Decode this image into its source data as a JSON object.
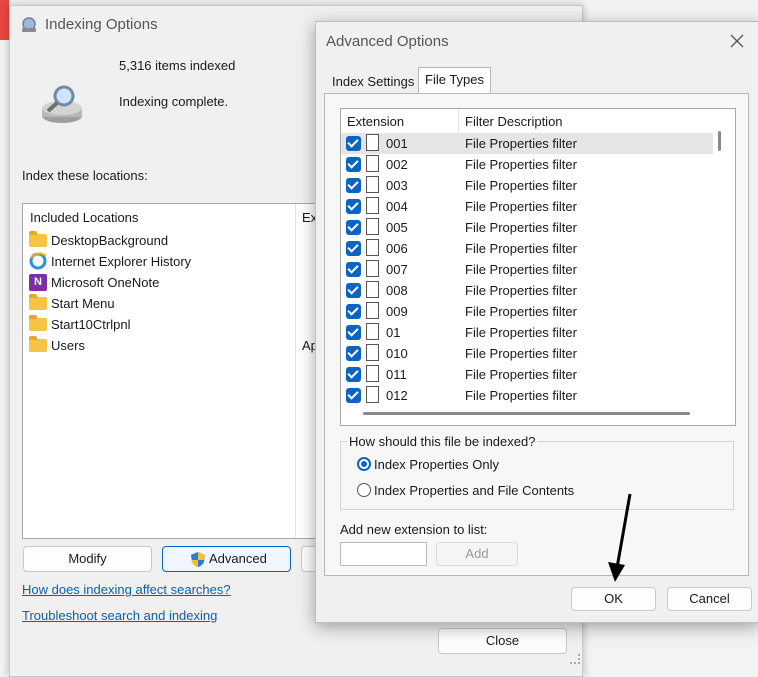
{
  "indexing_window": {
    "title": "Indexing Options",
    "items_indexed": "5,316 items indexed",
    "status": "Indexing complete.",
    "index_locations_label": "Index these locations:",
    "col_included": "Included Locations",
    "col_excluded_partial": "Ex",
    "locations": [
      {
        "name": "DesktopBackground",
        "icon": "folder-icon",
        "exclude": ""
      },
      {
        "name": "Internet Explorer History",
        "icon": "ie-icon",
        "exclude": ""
      },
      {
        "name": "Microsoft OneNote",
        "icon": "onenote-icon",
        "exclude": ""
      },
      {
        "name": "Start Menu",
        "icon": "folder-icon",
        "exclude": ""
      },
      {
        "name": "Start10Ctrlpnl",
        "icon": "folder-icon",
        "exclude": ""
      },
      {
        "name": "Users",
        "icon": "folder-icon",
        "exclude": "Ap"
      }
    ],
    "modify_label": "Modify",
    "advanced_label": "Advanced",
    "link_how": "How does indexing affect searches?",
    "link_troubleshoot": "Troubleshoot search and indexing",
    "close_label": "Close"
  },
  "advanced_dialog": {
    "title": "Advanced Options",
    "tabs": [
      {
        "label": "Index Settings",
        "active": false
      },
      {
        "label": "File Types",
        "active": true
      }
    ],
    "col_extension": "Extension",
    "col_filter": "Filter Description",
    "rows": [
      {
        "ext": "001",
        "filter": "File Properties filter",
        "checked": true
      },
      {
        "ext": "002",
        "filter": "File Properties filter",
        "checked": true
      },
      {
        "ext": "003",
        "filter": "File Properties filter",
        "checked": true
      },
      {
        "ext": "004",
        "filter": "File Properties filter",
        "checked": true
      },
      {
        "ext": "005",
        "filter": "File Properties filter",
        "checked": true
      },
      {
        "ext": "006",
        "filter": "File Properties filter",
        "checked": true
      },
      {
        "ext": "007",
        "filter": "File Properties filter",
        "checked": true
      },
      {
        "ext": "008",
        "filter": "File Properties filter",
        "checked": true
      },
      {
        "ext": "009",
        "filter": "File Properties filter",
        "checked": true
      },
      {
        "ext": "01",
        "filter": "File Properties filter",
        "checked": true
      },
      {
        "ext": "010",
        "filter": "File Properties filter",
        "checked": true
      },
      {
        "ext": "011",
        "filter": "File Properties filter",
        "checked": true
      },
      {
        "ext": "012",
        "filter": "File Properties filter",
        "checked": true
      }
    ],
    "group_label": "How should this file be indexed?",
    "radio_properties_only": "Index Properties Only",
    "radio_properties_contents": "Index Properties and File Contents",
    "selected_radio": "properties_only",
    "add_ext_label": "Add new extension to list:",
    "add_ext_value": "",
    "add_label": "Add",
    "ok_label": "OK",
    "cancel_label": "Cancel"
  },
  "colors": {
    "accent": "#0b63c4",
    "link": "#0a5fb4",
    "selected_row": "#e5e5e5"
  }
}
